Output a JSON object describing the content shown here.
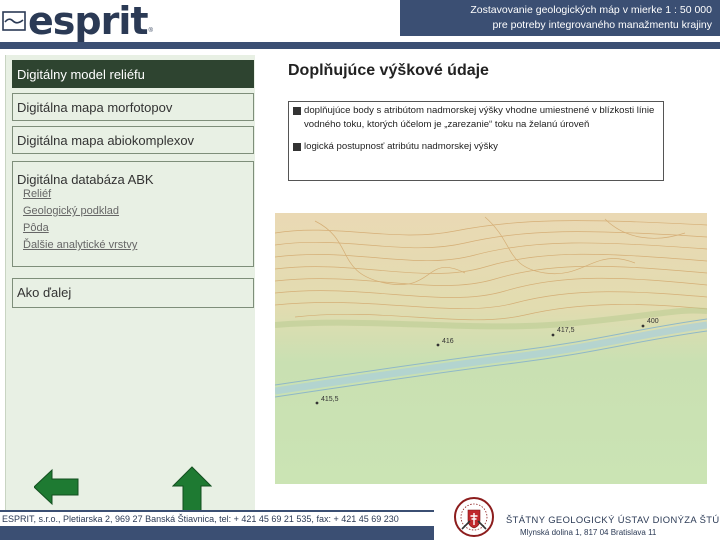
{
  "header": {
    "logo_text": "esprit",
    "logo_mark": "®",
    "title_line1": "Zostavovanie geologických máp v mierke 1 : 50 000",
    "title_line2": "pre potreby integrovaného manažmentu krajiny",
    "accent_color": "#3b4f73"
  },
  "sidebar": {
    "items": [
      {
        "label": "Digitálny model reliéfu",
        "active": true
      },
      {
        "label": "Digitálna mapa morfotopov"
      },
      {
        "label": "Digitálna mapa abiokomplexov"
      },
      {
        "label": "Digitálna databáza ABK",
        "links": [
          "Reliéf",
          "Geologický podklad",
          "Pôda",
          "Ďalšie analytické vrstvy"
        ]
      },
      {
        "label": "Ako ďalej"
      }
    ],
    "back_icon": "arrow-left-icon",
    "up_icon": "arrow-up-icon",
    "arrow_color": "#1e7a32"
  },
  "main": {
    "title": "Doplňujúce výškové údaje",
    "bullets": [
      "doplňujúce body s atribútom nadmorskej výšky vhodne umiestnené v blízkosti línie vodného toku, ktorých účelom je „zarezanie“ toku na želanú úroveň",
      "logická postupnosť atribútu nadmorskej výšky"
    ],
    "map_labels": [
      "400",
      "417,5",
      "416",
      "415,5"
    ]
  },
  "footer": {
    "contact": "ESPRIT, s.r.o., Pletiarska 2, 969 27 Banská Štiavnica, tel: + 421 45 69 21 535, fax: + 421 45 69 230",
    "org_name": "ŠTÁTNY GEOLOGICKÝ ÚSTAV DIONÝZA ŠTÚRA",
    "org_address": "Mlynská dolina 1, 817 04 Bratislava 11"
  }
}
